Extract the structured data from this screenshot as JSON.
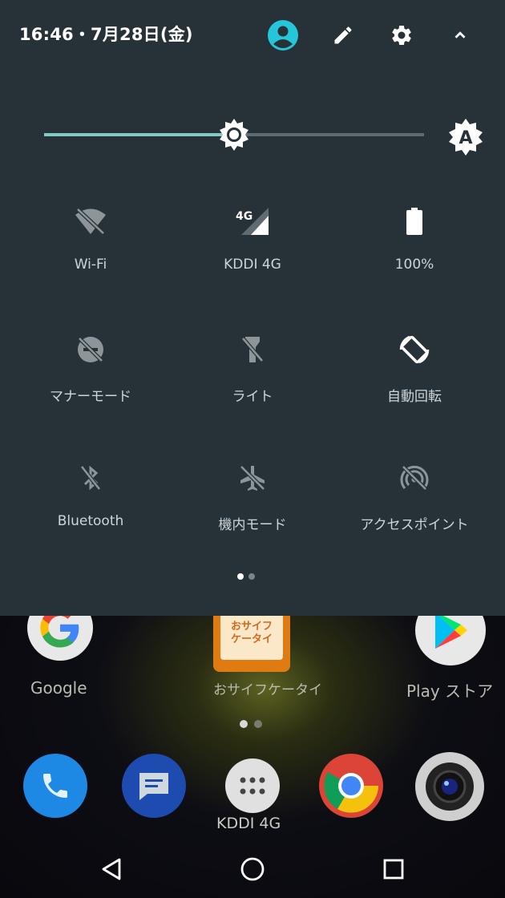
{
  "status": {
    "time_date": "16:46・7月28日(金)"
  },
  "header_icons": [
    "account-icon",
    "edit-icon",
    "settings-icon",
    "collapse-icon"
  ],
  "brightness": {
    "level": 0.5,
    "auto": true,
    "auto_icon_label": "A"
  },
  "tiles": [
    {
      "label": "Wi-Fi",
      "icon": "wifi-off-icon",
      "active": false
    },
    {
      "label": "KDDI 4G",
      "icon": "signal-4g-icon",
      "badge": "4G",
      "active": true
    },
    {
      "label": "100%",
      "icon": "battery-icon",
      "active": true
    },
    {
      "label": "マナーモード",
      "icon": "do-not-disturb-off-icon",
      "active": false
    },
    {
      "label": "ライト",
      "icon": "flashlight-off-icon",
      "active": false
    },
    {
      "label": "自動回転",
      "icon": "auto-rotate-icon",
      "active": true
    },
    {
      "label": "Bluetooth",
      "icon": "bluetooth-off-icon",
      "active": false
    },
    {
      "label": "機内モード",
      "icon": "airplane-off-icon",
      "active": false
    },
    {
      "label": "アクセスポイント",
      "icon": "hotspot-off-icon",
      "active": false
    }
  ],
  "qs_pages": {
    "count": 2,
    "current": 1
  },
  "home": {
    "apps": [
      {
        "label": "Google",
        "icon": "google-icon"
      },
      {
        "label": "おサイフケータイ",
        "icon": "osaifu-keitai-icon",
        "icon_text": "おサイフ\nケータイ"
      },
      {
        "label": "Play ストア",
        "icon": "play-store-icon"
      }
    ],
    "pages": {
      "count": 2,
      "current": 1
    },
    "dock": [
      "phone-icon",
      "messages-icon",
      "app-drawer-icon",
      "chrome-icon",
      "camera-icon"
    ],
    "dock_label": "KDDI 4G"
  },
  "nav": [
    "back-icon",
    "home-icon",
    "recents-icon"
  ],
  "colors": {
    "panel": "#263238",
    "accent": "#80cbc4",
    "account": "#26c6da",
    "inactive_icon": "#8d9599"
  }
}
